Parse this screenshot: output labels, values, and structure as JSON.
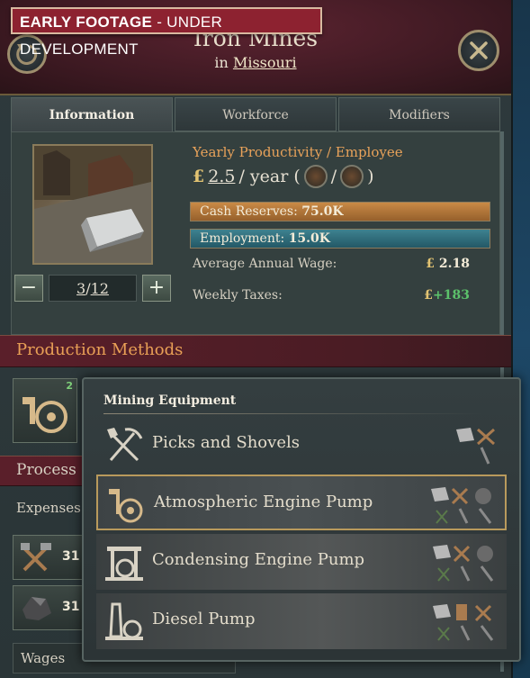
{
  "banner": {
    "bold": "EARLY FOOTAGE",
    "rest": " - UNDER DEVELOPMENT"
  },
  "header": {
    "title": "Iron Mines",
    "subtitle_prefix": "in ",
    "location": "Missouri"
  },
  "tabs": [
    {
      "label": "Information",
      "active": true
    },
    {
      "label": "Workforce",
      "active": false
    },
    {
      "label": "Modifiers",
      "active": false
    }
  ],
  "levels": {
    "minus": "−",
    "plus": "+",
    "current": "3",
    "sep": "/",
    "max": "12"
  },
  "info": {
    "productivity_label": "Yearly Productivity / Employee",
    "currency": "£",
    "productivity_value": "2.5",
    "productivity_unit": "/ year (",
    "productivity_mid": "/",
    "productivity_end": ")",
    "cash_label": "Cash Reserves: ",
    "cash_value": "75.0K",
    "employment_label": "Employment: ",
    "employment_value": "15.0K",
    "wage_label": "Average Annual Wage:",
    "wage_value": "2.18",
    "taxes_label": "Weekly Taxes:",
    "taxes_value": "+183"
  },
  "sections": {
    "production_methods": "Production Methods",
    "process": "Process",
    "expenses": "Expenses:",
    "wages": "Wages"
  },
  "pm_badge": "2",
  "expense_items": [
    {
      "icon": "tools-icon",
      "value": "31"
    },
    {
      "icon": "coal-icon",
      "value": "31"
    }
  ],
  "dropdown": {
    "title": "Mining Equipment",
    "options": [
      {
        "name": "Picks and Shovels",
        "icon": "pick-shovel-icon",
        "selected": false
      },
      {
        "name": "Atmospheric Engine Pump",
        "icon": "atmospheric-pump-icon",
        "selected": true
      },
      {
        "name": "Condensing Engine Pump",
        "icon": "condensing-pump-icon",
        "selected": false
      },
      {
        "name": "Diesel Pump",
        "icon": "diesel-pump-icon",
        "selected": false
      }
    ]
  },
  "colors": {
    "banner": "#8d2230",
    "header": "#4a1c24",
    "accent_orange": "#e8a25a",
    "cash_bar": "#c98a46",
    "employment_bar": "#3e8290",
    "green": "#5cc26b",
    "selected_border": "#b99a5c"
  }
}
